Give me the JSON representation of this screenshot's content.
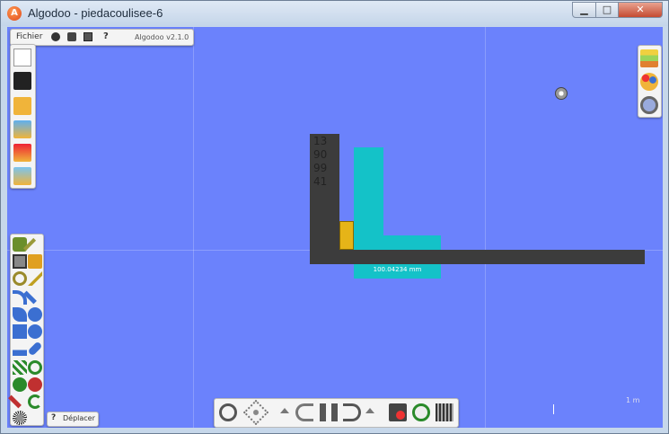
{
  "window": {
    "title": "Algodoo - piedacoulisee-6",
    "app_icon_glyph": "A",
    "min_glyph": "▁",
    "max_glyph": "□",
    "close_glyph": "✕"
  },
  "menubar": {
    "file_label": "Fichier",
    "help_glyph": "?",
    "version": "Algodoo v2.1.0"
  },
  "scene": {
    "digits": [
      "13",
      "90",
      "99",
      "41"
    ],
    "measure_label": "100.04234 mm",
    "scale_label": "1 m"
  },
  "status": {
    "help_glyph": "?",
    "tool_name": "Déplacer"
  },
  "colors": {
    "canvas": "#6b82fc",
    "dark_body": "#3c3c3c",
    "cyan_body": "#14c2c8",
    "yellow_body": "#e6b418",
    "panel": "#f4f4f4"
  }
}
